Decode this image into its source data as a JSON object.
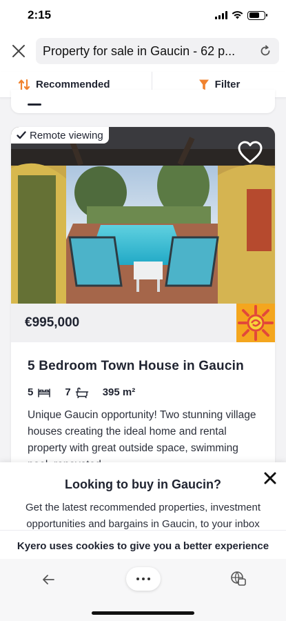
{
  "status": {
    "time": "2:15"
  },
  "browser": {
    "url_title": "Property for sale in Gaucin - 62 p..."
  },
  "toolbar_sort": {
    "sort_label": "Recommended",
    "filter_label": "Filter"
  },
  "listing": {
    "badge": "Remote viewing",
    "price": "€995,000",
    "title": "5 Bedroom Town House in Gaucin",
    "bedrooms": "5",
    "bathrooms": "7",
    "area": "395 m²",
    "description": "Unique Gaucin opportunity! Two stunning village houses creating the ideal home and rental property with great outside space, swimming pool, renovated..."
  },
  "newsletter": {
    "title": "Looking to buy in Gaucin?",
    "text": "Get the latest recommended properties, investment opportunities and bargains in Gaucin, to your inbox"
  },
  "cookie": {
    "text": "Kyero uses cookies to give you a better experience"
  },
  "colors": {
    "accent_orange": "#f0822e",
    "cookie_button_blue": "#2f4bd6",
    "text_dark": "#1f2330"
  },
  "icons": [
    "close-icon",
    "reload-icon",
    "sort-icon",
    "filter-icon",
    "check-icon",
    "heart-icon",
    "bed-icon",
    "bath-icon",
    "back-arrow-icon",
    "more-icon",
    "tabs-icon"
  ]
}
